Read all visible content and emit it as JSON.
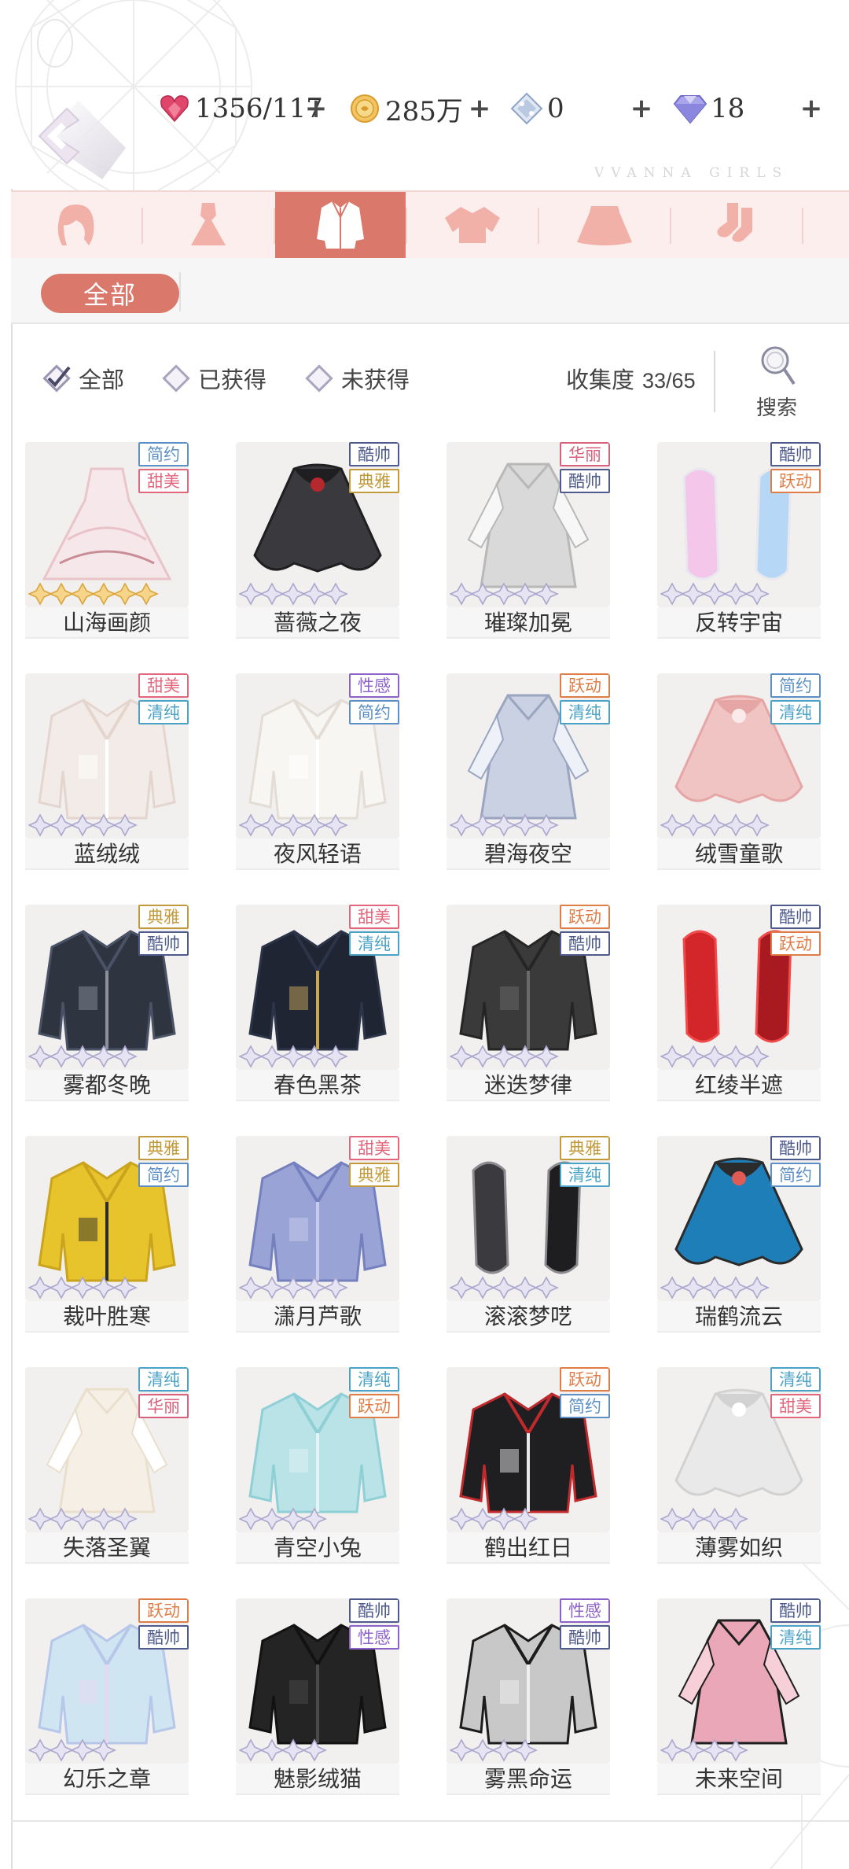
{
  "header": {
    "brand": "VVANNA GIRLS",
    "currencies": [
      {
        "icon": "stamina-heart-icon",
        "value": "1356/117",
        "color": "#e0466b"
      },
      {
        "icon": "gold-coin-icon",
        "value": "285万",
        "color": "#f0b546"
      },
      {
        "icon": "crystal-icon",
        "value": "0",
        "color": "#9fb4d6"
      },
      {
        "icon": "diamond-icon",
        "value": "18",
        "color": "#8f8bd8"
      }
    ]
  },
  "categories": [
    {
      "icon": "hair-icon"
    },
    {
      "icon": "dress-icon"
    },
    {
      "icon": "coat-icon",
      "active": true
    },
    {
      "icon": "top-icon"
    },
    {
      "icon": "skirt-icon"
    },
    {
      "icon": "socks-icon"
    }
  ],
  "subfilter": {
    "all_label": "全部"
  },
  "filters": [
    {
      "label": "全部",
      "checked": true
    },
    {
      "label": "已获得",
      "checked": false
    },
    {
      "label": "未获得",
      "checked": false
    }
  ],
  "collection": {
    "label": "收集度",
    "value": "33/65"
  },
  "search": {
    "label": "搜索"
  },
  "tag_colors": {
    "简约": "#5b8fc5",
    "甜美": "#e2677d",
    "酷帅": "#4e5b8c",
    "典雅": "#c39a3b",
    "华丽": "#d7607c",
    "跃动": "#e07d46",
    "性感": "#8c62c8",
    "清纯": "#4aa3c6"
  },
  "items": [
    {
      "name": "山海画颜",
      "tags": [
        "简约",
        "甜美"
      ],
      "stars": 6,
      "gold": true,
      "art": "gown",
      "colors": [
        "#f6e7ea",
        "#e9c2c8",
        "#c98d96"
      ]
    },
    {
      "name": "蔷薇之夜",
      "tags": [
        "酷帅",
        "典雅"
      ],
      "stars": 5,
      "gold": false,
      "art": "cape",
      "colors": [
        "#3a3a3e",
        "#1f1f22",
        "#b5282e"
      ]
    },
    {
      "name": "璀璨加冕",
      "tags": [
        "华丽",
        "酷帅"
      ],
      "stars": 5,
      "gold": false,
      "art": "robe",
      "colors": [
        "#d9d9d9",
        "#b8b8b8",
        "#f7f7f7"
      ]
    },
    {
      "name": "反转宇宙",
      "tags": [
        "酷帅",
        "跃动"
      ],
      "stars": 5,
      "gold": false,
      "art": "sleeves",
      "colors": [
        "#f3c6ea",
        "#b6d7f5",
        "#e8e8ee"
      ]
    },
    {
      "name": "蓝绒绒",
      "tags": [
        "甜美",
        "清纯"
      ],
      "stars": 5,
      "gold": false,
      "art": "jacket",
      "colors": [
        "#f3ebe7",
        "#e4d6cf",
        "#ffffff"
      ]
    },
    {
      "name": "夜风轻语",
      "tags": [
        "性感",
        "简约"
      ],
      "stars": 5,
      "gold": false,
      "art": "jacket",
      "colors": [
        "#f8f6f3",
        "#e3ddd5",
        "#ffffff"
      ]
    },
    {
      "name": "碧海夜空",
      "tags": [
        "跃动",
        "清纯"
      ],
      "stars": 5,
      "gold": false,
      "art": "robe",
      "colors": [
        "#c9d1e3",
        "#9aa5c0",
        "#eef1f7"
      ]
    },
    {
      "name": "绒雪童歌",
      "tags": [
        "简约",
        "清纯"
      ],
      "stars": 5,
      "gold": false,
      "art": "cape",
      "colors": [
        "#f0c4c3",
        "#e7a6a6",
        "#fbeaea"
      ]
    },
    {
      "name": "雾都冬晚",
      "tags": [
        "典雅",
        "酷帅"
      ],
      "stars": 5,
      "gold": false,
      "art": "jacket",
      "colors": [
        "#2f3540",
        "#4a5366",
        "#8a8f99"
      ]
    },
    {
      "name": "春色黑茶",
      "tags": [
        "甜美",
        "清纯"
      ],
      "stars": 5,
      "gold": false,
      "art": "jacket",
      "colors": [
        "#1f2533",
        "#2c3447",
        "#c9a85a"
      ]
    },
    {
      "name": "迷迭梦律",
      "tags": [
        "跃动",
        "酷帅"
      ],
      "stars": 5,
      "gold": false,
      "art": "jacket",
      "colors": [
        "#3a3a3a",
        "#252525",
        "#6a6a6a"
      ]
    },
    {
      "name": "红绫半遮",
      "tags": [
        "酷帅",
        "跃动"
      ],
      "stars": 5,
      "gold": false,
      "art": "sleeves",
      "colors": [
        "#d3262b",
        "#a81a1f",
        "#f04a4a"
      ]
    },
    {
      "name": "裁叶胜寒",
      "tags": [
        "典雅",
        "简约"
      ],
      "stars": 5,
      "gold": false,
      "art": "jacket",
      "colors": [
        "#e7c32c",
        "#c9a41c",
        "#2d2d2d"
      ]
    },
    {
      "name": "潇月芦歌",
      "tags": [
        "甜美",
        "典雅"
      ],
      "stars": 5,
      "gold": false,
      "art": "jacket",
      "colors": [
        "#9aa3d6",
        "#7580bf",
        "#c6cbec"
      ]
    },
    {
      "name": "滚滚梦呓",
      "tags": [
        "典雅",
        "清纯"
      ],
      "stars": 5,
      "gold": false,
      "art": "sleeves",
      "colors": [
        "#3b3b3f",
        "#1e1e21",
        "#8b8b90"
      ]
    },
    {
      "name": "瑞鹤流云",
      "tags": [
        "酷帅",
        "简约"
      ],
      "stars": 5,
      "gold": false,
      "art": "cape",
      "colors": [
        "#1e7fb8",
        "#2b2b2b",
        "#e05b55"
      ]
    },
    {
      "name": "失落圣翼",
      "tags": [
        "清纯",
        "华丽"
      ],
      "stars": 5,
      "gold": false,
      "art": "robe",
      "colors": [
        "#f5efe6",
        "#eadfcc",
        "#ffffff"
      ]
    },
    {
      "name": "青空小兔",
      "tags": [
        "清纯",
        "跃动"
      ],
      "stars": 4,
      "gold": false,
      "art": "jacket",
      "colors": [
        "#b9e3e6",
        "#8fd0d6",
        "#e2f4f5"
      ]
    },
    {
      "name": "鹤出红日",
      "tags": [
        "跃动",
        "简约"
      ],
      "stars": 4,
      "gold": false,
      "art": "jacket",
      "colors": [
        "#1f1f22",
        "#c12a2d",
        "#e8e8e8"
      ]
    },
    {
      "name": "薄雾如织",
      "tags": [
        "清纯",
        "甜美"
      ],
      "stars": 4,
      "gold": false,
      "art": "cape",
      "colors": [
        "#e9e9e9",
        "#d2d2d2",
        "#ffffff"
      ]
    },
    {
      "name": "幻乐之章",
      "tags": [
        "跃动",
        "酷帅"
      ],
      "stars": 4,
      "gold": false,
      "art": "jacket",
      "colors": [
        "#cfe6f2",
        "#b7c7ea",
        "#e9d7f2"
      ]
    },
    {
      "name": "魅影绒猫",
      "tags": [
        "酷帅",
        "性感"
      ],
      "stars": 4,
      "gold": false,
      "art": "jacket",
      "colors": [
        "#242424",
        "#121212",
        "#4a4a4a"
      ]
    },
    {
      "name": "雾黑命运",
      "tags": [
        "性感",
        "酷帅"
      ],
      "stars": 4,
      "gold": false,
      "art": "jacket",
      "colors": [
        "#c8c8c8",
        "#1c1c1c",
        "#efefef"
      ]
    },
    {
      "name": "未来空间",
      "tags": [
        "酷帅",
        "清纯"
      ],
      "stars": 4,
      "gold": false,
      "art": "robe",
      "colors": [
        "#eaa7b8",
        "#1f1f1f",
        "#f6cfd9"
      ]
    }
  ]
}
